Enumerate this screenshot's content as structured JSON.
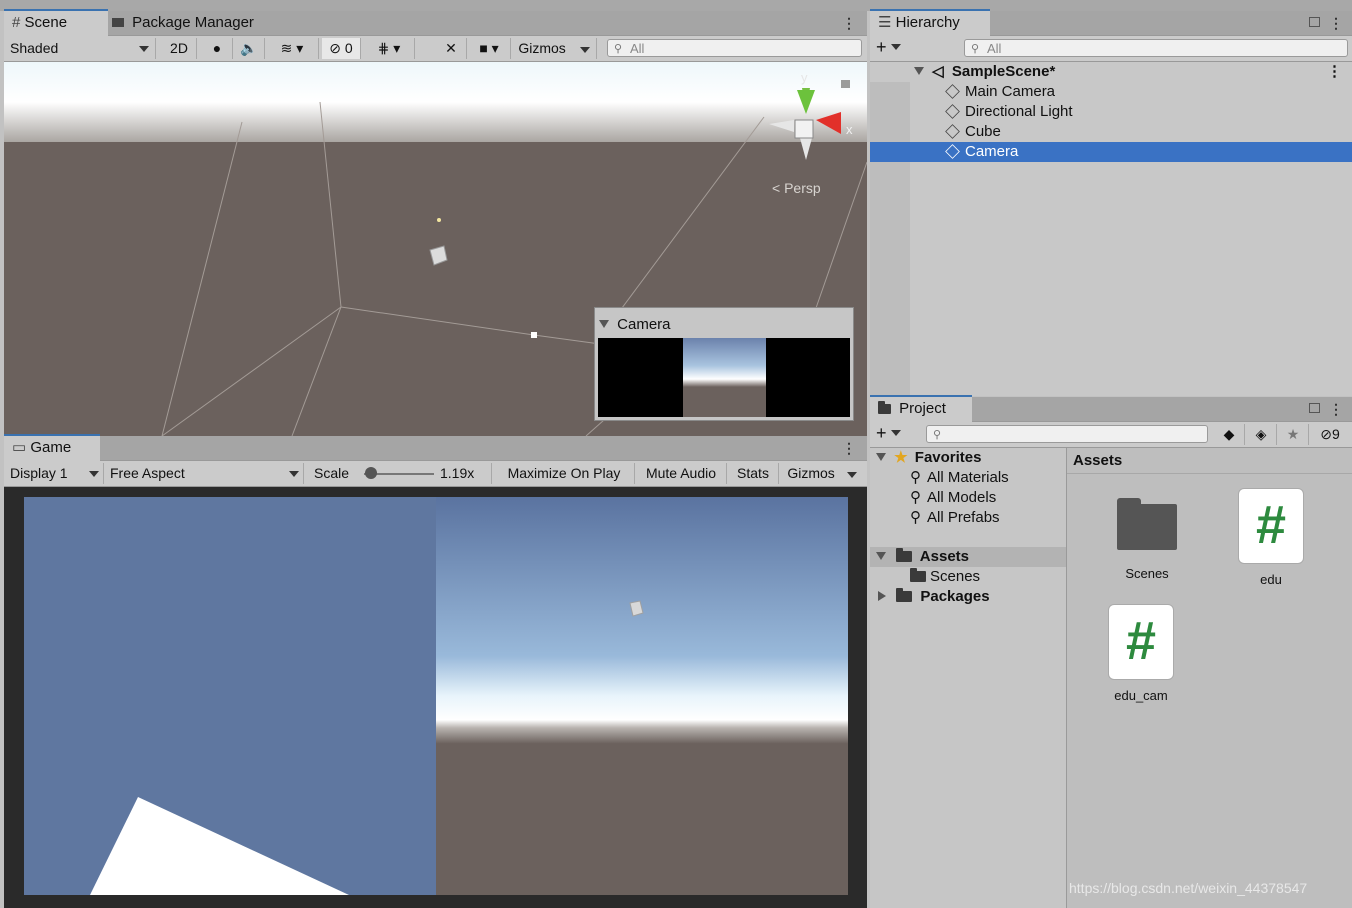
{
  "scene_panel": {
    "tabs": [
      "Scene",
      "Package Manager"
    ],
    "shading_mode": "Shaded",
    "mode_2d": "2D",
    "hidden_count": "0",
    "gizmos_label": "Gizmos",
    "search_placeholder": "All",
    "view_label": "Persp",
    "axis_y": "y",
    "axis_x": "x",
    "camera_preview_title": "Camera"
  },
  "game_panel": {
    "tab": "Game",
    "display": "Display 1",
    "aspect": "Free Aspect",
    "scale_label": "Scale",
    "scale_value": "1.19x",
    "scale_fraction": 0.12,
    "buttons": [
      "Maximize On Play",
      "Mute Audio",
      "Stats",
      "Gizmos"
    ]
  },
  "hierarchy": {
    "tab": "Hierarchy",
    "search_placeholder": "All",
    "scene_name": "SampleScene*",
    "items": [
      "Main Camera",
      "Directional Light",
      "Cube",
      "Camera"
    ],
    "selected": "Camera"
  },
  "project": {
    "tab": "Project",
    "hidden_count": "9",
    "favorites_label": "Favorites",
    "favorites": [
      "All Materials",
      "All Models",
      "All Prefabs"
    ],
    "assets_label": "Assets",
    "assets_children": [
      "Scenes"
    ],
    "packages_label": "Packages",
    "breadcrumb": "Assets",
    "grid_items": [
      {
        "name": "Scenes",
        "kind": "folder"
      },
      {
        "name": "edu",
        "kind": "script"
      },
      {
        "name": "edu_cam",
        "kind": "script"
      }
    ],
    "script_glyph": "#"
  },
  "watermark": "https://blog.csdn.net/weixin_44378547",
  "colors": {
    "selection": "#3a72c4",
    "sky_game": "#5f77a0",
    "ground": "#6b615d",
    "script_green": "#2d8a3e"
  }
}
